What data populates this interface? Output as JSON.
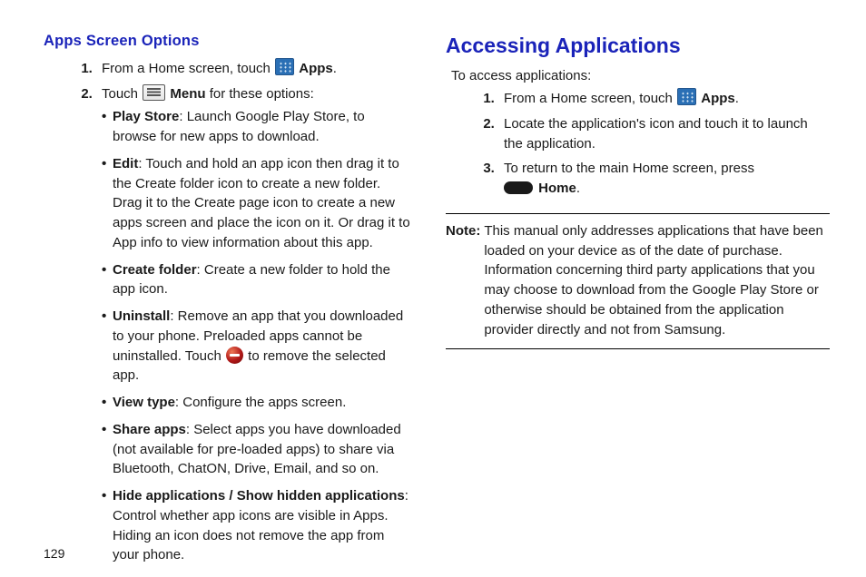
{
  "page_number": "129",
  "left": {
    "heading": "Apps Screen Options",
    "step1_a": "From a Home screen, touch ",
    "step1_b": "Apps",
    "step1_c": ".",
    "step2_a": "Touch ",
    "step2_b": "Menu",
    "step2_c": " for these options:",
    "bul1_t": "Play Store",
    "bul1_b": ": Launch Google Play Store, to browse for new apps to download.",
    "bul2_t": "Edit",
    "bul2_b": ": Touch and hold an app icon then drag it to the Create folder icon to create a new folder. Drag it to the Create page icon to create a new apps screen and place the icon on it. Or drag it to App info to view information about this app.",
    "bul3_t": "Create folder",
    "bul3_b": ": Create a new folder to hold the app icon.",
    "bul4_t": "Uninstall",
    "bul4_b1": ": Remove an app that you downloaded to your phone. Preloaded apps cannot be uninstalled. Touch ",
    "bul4_b2": " to remove the selected app.",
    "bul5_t": "View type",
    "bul5_b": ": Configure the apps screen.",
    "bul6_t": "Share apps",
    "bul6_b": ": Select apps you have downloaded (not available for pre-loaded apps) to share via Bluetooth, ChatON, Drive, Email, and so on.",
    "bul7_t": "Hide applications / Show hidden applications",
    "bul7_b": ": Control whether app icons are visible in Apps. Hiding an icon does not remove the app from your phone."
  },
  "right": {
    "heading": "Accessing Applications",
    "intro": "To access applications:",
    "s1_a": "From a Home screen, touch ",
    "s1_b": "Apps",
    "s1_c": ".",
    "s2": "Locate the application's icon and touch it to launch the application.",
    "s3_a": "To return to the main Home screen, press ",
    "s3_b": "Home",
    "s3_c": ".",
    "note_label": "Note:",
    "note_body": "This manual only addresses applications that have been loaded on your device as of the date of purchase. Information concerning third party applications that you may choose to download from the Google Play Store or otherwise should be obtained from the application provider directly and not from Samsung."
  }
}
